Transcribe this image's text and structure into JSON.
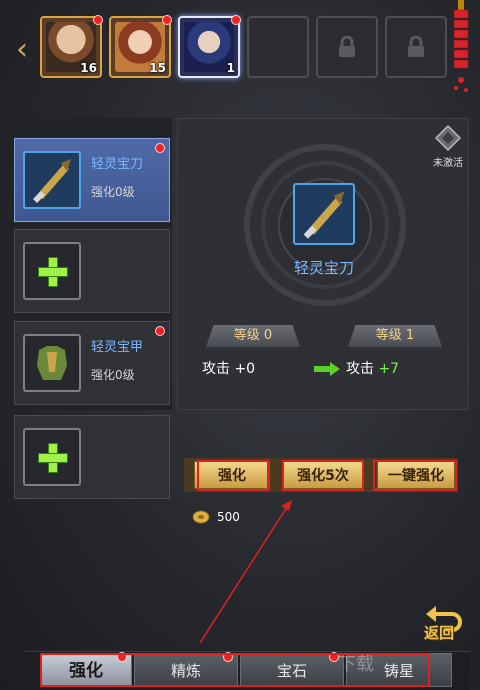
{
  "hero_bar": {
    "heroes": [
      {
        "level": "16",
        "state": "active"
      },
      {
        "level": "15",
        "state": "active"
      },
      {
        "level": "1",
        "state": "selected"
      }
    ],
    "locked_slots": 3,
    "back_icon": "chevron-left-icon",
    "lock_icon": "lock-icon"
  },
  "equipment_list": [
    {
      "name": "轻灵宝刀",
      "level_text": "强化0级",
      "selected": true,
      "has_item": true
    },
    {
      "name": "",
      "level_text": "",
      "selected": false,
      "has_item": false
    },
    {
      "name": "轻灵宝甲",
      "level_text": "强化0级",
      "selected": false,
      "has_item": true
    },
    {
      "name": "",
      "level_text": "",
      "selected": false,
      "has_item": false
    }
  ],
  "detail": {
    "item_name": "轻灵宝刀",
    "inactive_label": "未激活",
    "level_current": "等级 0",
    "level_next": "等级 1",
    "attack_label": "攻击",
    "attack_current": "+0",
    "attack_next": "+7"
  },
  "actions": {
    "enhance": "强化",
    "enhance_5": "强化5次",
    "enhance_all": "一键强化",
    "cost": "500"
  },
  "return_label": "返回",
  "tabs": [
    {
      "label": "强化",
      "active": true
    },
    {
      "label": "精炼",
      "active": false
    },
    {
      "label": "宝石",
      "active": false
    },
    {
      "label": "铸星",
      "active": false
    }
  ],
  "watermark": "下载",
  "colors": {
    "highlight_red": "#e02020",
    "gold": "#c89b42",
    "item_blue": "#7ab8ff",
    "increase_green": "#7cf04a"
  }
}
